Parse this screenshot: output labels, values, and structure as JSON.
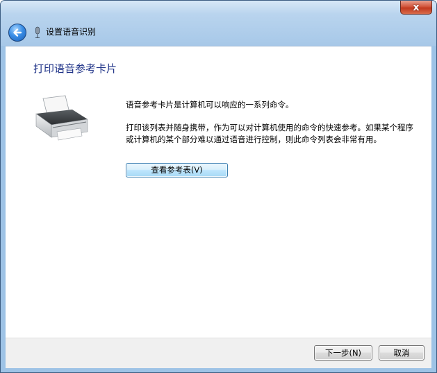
{
  "window": {
    "close_glyph": "x",
    "nav_title": "设置语音识别"
  },
  "page": {
    "heading": "打印语音参考卡片",
    "para1": "语音参考卡片是计算机可以响应的一系列命令。",
    "para2": "打印该列表并随身携带，作为可以对计算机使用的命令的快速参考。如果某个程序或计算机的某个部分难以通过语音进行控制，则此命令列表会非常有用。",
    "view_button": "查看参考表(V)"
  },
  "footer": {
    "next_button": "下一步(N)",
    "cancel_button": "取消"
  },
  "icons": {
    "back": "back-arrow-icon",
    "microphone": "microphone-icon",
    "printer": "printer-icon",
    "close": "close-icon"
  },
  "colors": {
    "heading": "#1e3287",
    "frame": "#a7c8e8",
    "close": "#c2391f"
  }
}
